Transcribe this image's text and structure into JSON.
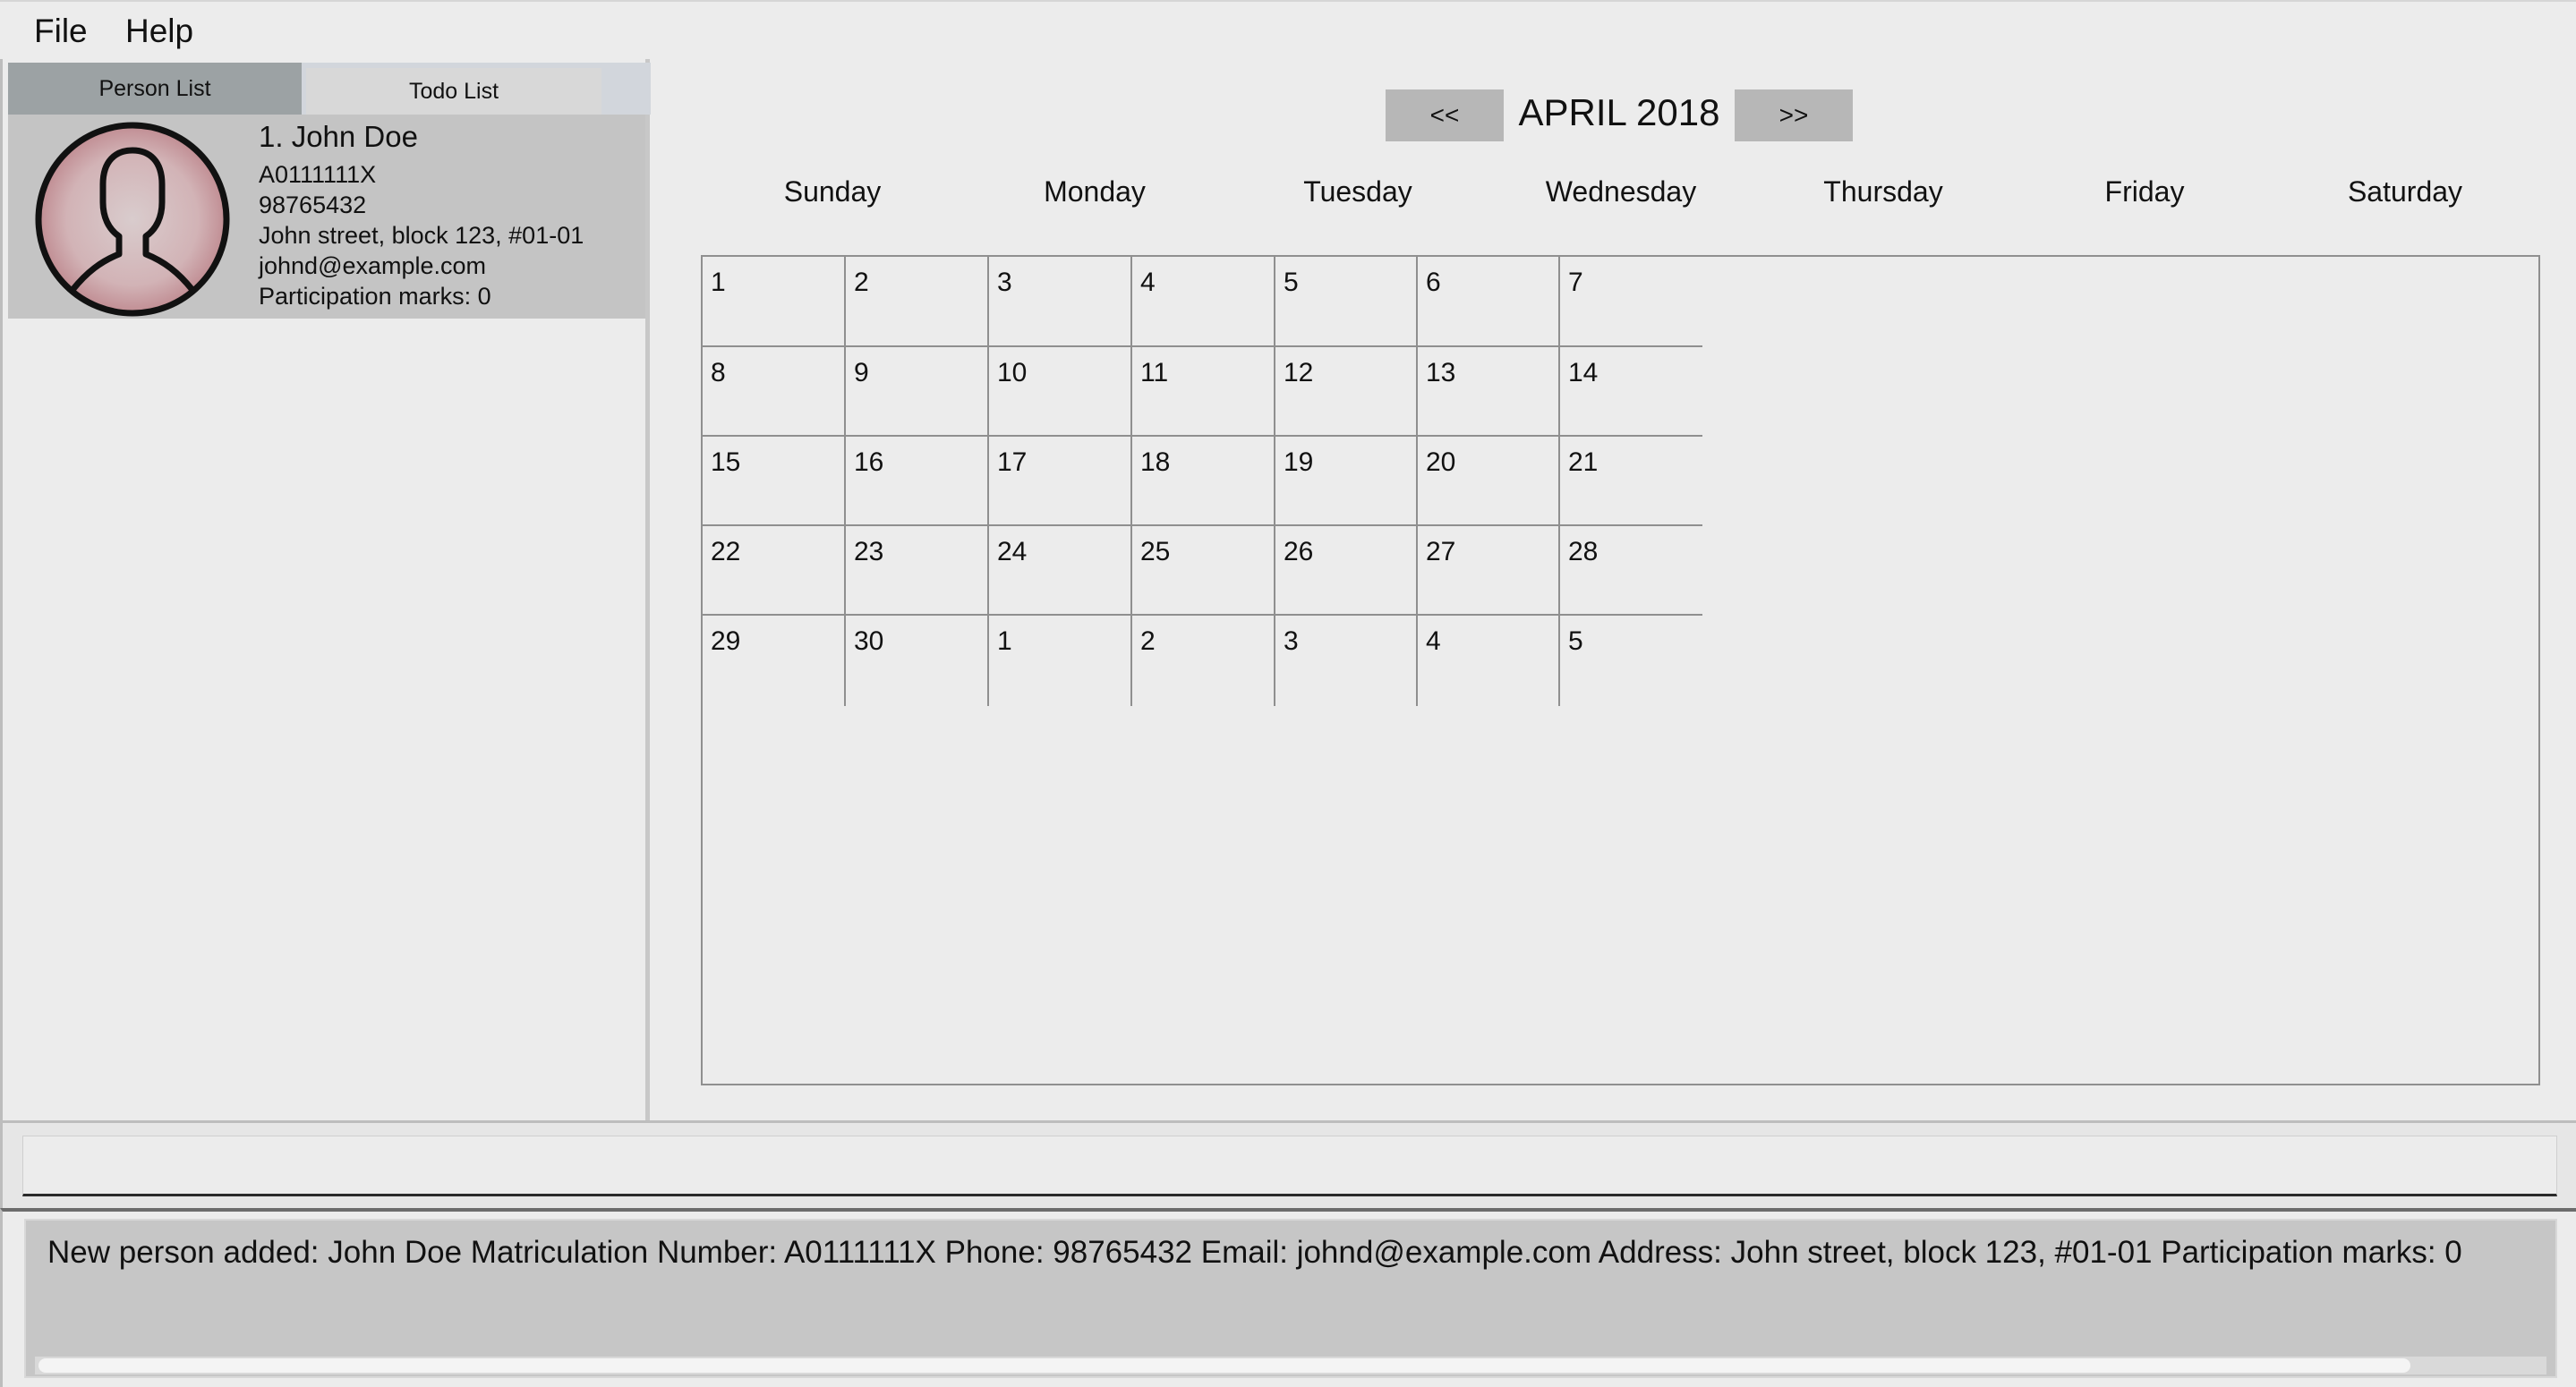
{
  "menu": {
    "file_label": "File",
    "help_label": "Help"
  },
  "tabs": {
    "person_list": "Person List",
    "todo_list": "Todo List"
  },
  "person": {
    "name": "1.  John Doe",
    "matric": "A0111111X",
    "phone": "98765432",
    "address": "John street, block 123, #01-01",
    "email": "johnd@example.com",
    "marks": "Participation marks: 0"
  },
  "calendar": {
    "prev_label": "<<",
    "next_label": ">>",
    "title": "APRIL 2018",
    "day_names": [
      "Sunday",
      "Monday",
      "Tuesday",
      "Wednesday",
      "Thursday",
      "Friday",
      "Saturday"
    ],
    "weeks": [
      [
        "1",
        "2",
        "3",
        "4",
        "5",
        "6",
        "7"
      ],
      [
        "8",
        "9",
        "10",
        "11",
        "12",
        "13",
        "14"
      ],
      [
        "15",
        "16",
        "17",
        "18",
        "19",
        "20",
        "21"
      ],
      [
        "22",
        "23",
        "24",
        "25",
        "26",
        "27",
        "28"
      ],
      [
        "29",
        "30",
        "1",
        "2",
        "3",
        "4",
        "5"
      ]
    ]
  },
  "command": {
    "value": "",
    "placeholder": ""
  },
  "result": {
    "text": "New person added: John Doe Matriculation Number: A0111111X Phone: 98765432 Email: johnd@example.com Address: John street, block 123, #01-01 Participation marks: 0"
  },
  "colors": {
    "background": "#ececec",
    "selected_tab": "#9ca2a4",
    "card": "#c4c4c4",
    "nav_button": "#b7b7b7",
    "grid_line": "#8f8f8f",
    "avatar_glow": "#c9a0a4"
  }
}
